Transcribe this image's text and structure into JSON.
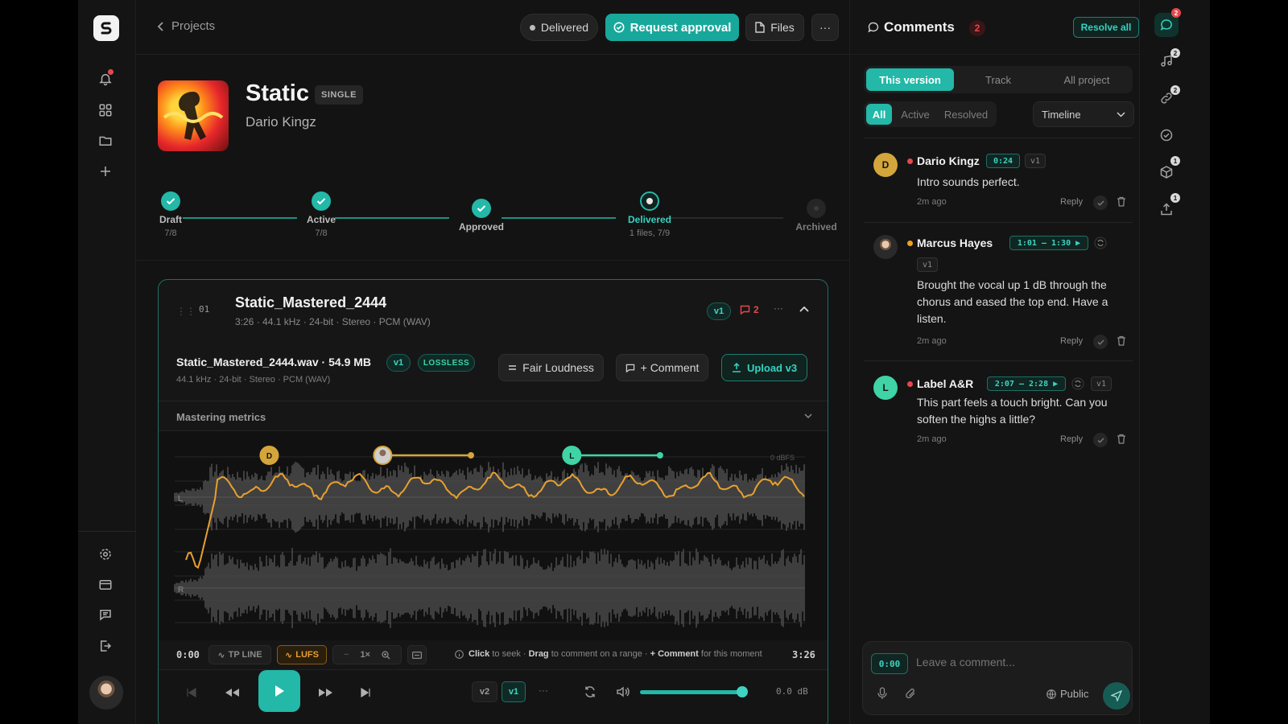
{
  "breadcrumb": {
    "label": "Projects"
  },
  "header": {
    "status_label": "Delivered",
    "request_approval_label": "Request approval",
    "files_label": "Files",
    "more_label": "···"
  },
  "release": {
    "title": "Static",
    "type_badge": "SINGLE",
    "artist": "Dario Kingz"
  },
  "steps": [
    {
      "name": "Draft",
      "sub": "7/8"
    },
    {
      "name": "Active",
      "sub": "7/8"
    },
    {
      "name": "Approved",
      "sub": ""
    },
    {
      "name": "Delivered",
      "sub": "1 files, 7/9"
    },
    {
      "name": "Archived",
      "sub": ""
    }
  ],
  "track": {
    "index": "01",
    "name": "Static_Mastered_2444",
    "meta": "3:26 · 44.1 kHz · 24-bit · Stereo · PCM (WAV)",
    "version": "v1",
    "comment_count": "2",
    "more_label": "···"
  },
  "file": {
    "name": "Static_Mastered_2444.wav · 54.9 MB",
    "meta": "44.1 kHz · 24-bit · Stereo · PCM (WAV)",
    "version": "v1",
    "badge": "LOSSLESS",
    "fair_loudness_label": "Fair Loudness",
    "comment_label": "+ Comment",
    "upload_label": "Upload v3"
  },
  "metrics": {
    "label": "Mastering metrics"
  },
  "waveform": {
    "dbfs_label": "0 dBFS",
    "channel_l": "L",
    "channel_r": "R",
    "markers": [
      {
        "initial": "D",
        "color": "#d4a53a",
        "start": 0.15,
        "end": null
      },
      {
        "initial": "",
        "color": "#d4a53a",
        "start": 0.33,
        "end": 0.47
      },
      {
        "initial": "L",
        "color": "#3fd3a6",
        "start": 0.63,
        "end": 0.77
      }
    ]
  },
  "controls": {
    "time_start": "0:00",
    "tp_line": "TP LINE",
    "lufs": "LUFS",
    "zoom": "1×",
    "hint_click": "Click",
    "hint_seek": " to seek · ",
    "hint_drag": "Drag",
    "hint_range": " to comment on a range · ",
    "hint_comment": "+ Comment",
    "hint_moment": " for this moment",
    "time_end": "3:26"
  },
  "player": {
    "v2": "v2",
    "v1": "v1",
    "more": "···",
    "db": "0.0 dB",
    "volume": 0.96
  },
  "comments_panel": {
    "title": "Comments",
    "count": "2",
    "resolve_all": "Resolve all",
    "tabs": [
      "This version",
      "Track",
      "All project"
    ],
    "filters": [
      "All",
      "Active",
      "Resolved"
    ],
    "sort": "Timeline",
    "items": [
      {
        "avatar": "D",
        "avatar_color": "#d4a53a",
        "status_color": "#e5484d",
        "name": "Dario Kingz",
        "time": "0:24",
        "version": "v1",
        "body": "Intro sounds perfect.",
        "ago": "2m ago",
        "reply": "Reply"
      },
      {
        "avatar": "",
        "avatar_color": "#cfcfcf",
        "status_color": "#f0a020",
        "name": "Marcus Hayes",
        "time": "1:01 – 1:30 ▶",
        "version": "v1",
        "body": "Brought the vocal up 1 dB through the chorus and eased the top end. Have a listen.",
        "ago": "2m ago",
        "reply": "Reply"
      },
      {
        "avatar": "L",
        "avatar_color": "#3fd3a6",
        "status_color": "#e5484d",
        "name": "Label A&R",
        "time": "2:07 – 2:28 ▶",
        "version": "v1",
        "body": "This part feels a touch bright. Can you soften the highs a little?",
        "ago": "2m ago",
        "reply": "Reply"
      }
    ],
    "composer": {
      "time": "0:00",
      "placeholder": "Leave a comment...",
      "visibility": "Public"
    }
  },
  "rail": {
    "badges": [
      "2",
      "2",
      "2",
      "1",
      "1"
    ]
  },
  "colors": {
    "accent": "#17a89b",
    "accent_text": "#37d2c1",
    "lufs_line": "#e8a030",
    "alert": "#e5484d"
  }
}
